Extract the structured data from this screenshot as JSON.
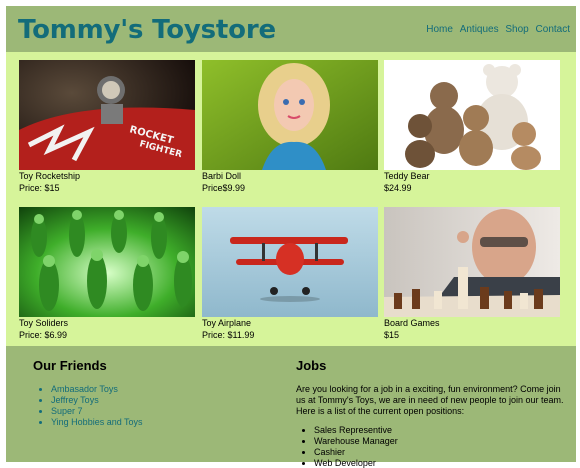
{
  "header": {
    "title": "Tommy's Toystore",
    "nav": [
      "Home",
      "Antiques",
      "Shop",
      "Contact"
    ]
  },
  "products": [
    {
      "name": "Toy Rocketship",
      "price": "Price: $15",
      "image": "toy-rocketship-photo"
    },
    {
      "name": "Barbi Doll",
      "price": "Price$9.99",
      "image": "barbie-doll-photo"
    },
    {
      "name": "Teddy Bear",
      "price": "$24.99",
      "image": "teddy-bears-photo"
    },
    {
      "name": "Toy Soliders",
      "price": "Price: $6.99",
      "image": "toy-soldiers-photo"
    },
    {
      "name": "Toy Airplane",
      "price": "Price: $11.99",
      "image": "toy-airplane-photo"
    },
    {
      "name": "Board Games",
      "price": "$15",
      "image": "chess-game-photo"
    }
  ],
  "friends": {
    "heading": "Our Friends",
    "links": [
      "Ambasador Toys",
      "Jeffrey Toys",
      "Super 7",
      "Ying Hobbies and Toys"
    ]
  },
  "jobs": {
    "heading": "Jobs",
    "intro": "Are you looking for a job in a exciting, fun environment? Come join us at Tommy's Toys, we are in need of new people to join our team. Here is a list of the current open positions:",
    "positions": [
      "Sales Representive",
      "Warehouse Manager",
      "Cashier",
      "Web Developer"
    ]
  },
  "colors": {
    "header_bg": "#9cb877",
    "grid_bg": "#d6f49a",
    "accent": "#136c7a"
  }
}
